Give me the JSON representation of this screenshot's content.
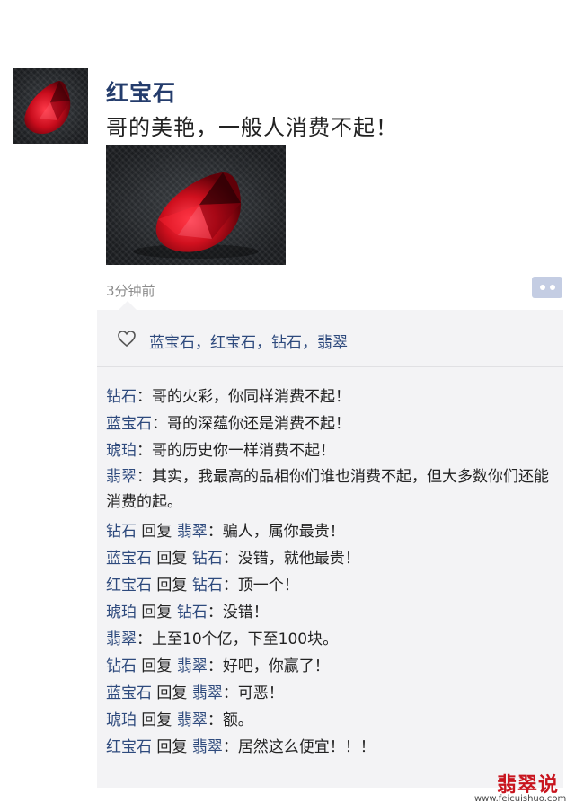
{
  "post": {
    "username": "红宝石",
    "text": "哥的美艳，一般人消费不起！",
    "timestamp": "3分钟前"
  },
  "likes": {
    "names": "蓝宝石，红宝石，钻石，翡翠"
  },
  "comments": [
    {
      "author": "钻石",
      "sep": "：",
      "text": "哥的火彩，你同样消费不起！"
    },
    {
      "author": "蓝宝石",
      "sep": "：",
      "text": "哥的深蕴你还是消费不起！"
    },
    {
      "author": "琥珀",
      "sep": "：",
      "text": "哥的历史你一样消费不起！"
    },
    {
      "author": "翡翠",
      "sep": "：",
      "text": "其实，我最高的品相你们谁也消费不起，但大多数你们还能消费的起。"
    },
    {
      "author": "钻石",
      "reply_word": "回复",
      "reply_to": "翡翠",
      "sep": "：",
      "text": "骗人，属你最贵！"
    },
    {
      "author": "蓝宝石",
      "reply_word": "回复",
      "reply_to": "钻石",
      "sep": "：",
      "text": "没错，就他最贵！"
    },
    {
      "author": "红宝石",
      "reply_word": "回复",
      "reply_to": "钻石",
      "sep": "：",
      "text": "顶一个！"
    },
    {
      "author": "琥珀",
      "reply_word": "回复",
      "reply_to": "钻石",
      "sep": "：",
      "text": "没错！"
    },
    {
      "author": "翡翠",
      "sep": "：",
      "text": "上至10个亿，下至100块。"
    },
    {
      "author": "钻石",
      "reply_word": "回复",
      "reply_to": "翡翠",
      "sep": "：",
      "text": "好吧，你赢了！"
    },
    {
      "author": "蓝宝石",
      "reply_word": "回复",
      "reply_to": "翡翠",
      "sep": "：",
      "text": "可恶！"
    },
    {
      "author": "琥珀",
      "reply_word": "回复",
      "reply_to": "翡翠",
      "sep": "：",
      "text": "额。"
    },
    {
      "author": "红宝石",
      "reply_word": "回复",
      "reply_to": "翡翠",
      "sep": "：",
      "text": "居然这么便宜！！！"
    }
  ],
  "watermark": {
    "logo": "翡翠说",
    "url": "www.feicuishuo.com"
  },
  "icons": {
    "like": "heart-icon",
    "more": "more-dots-icon"
  },
  "colors": {
    "name_blue": "#2e4a7d",
    "panel_bg": "#f3f3f5",
    "more_button": "#c4cde3",
    "watermark_red": "#c8141e"
  }
}
